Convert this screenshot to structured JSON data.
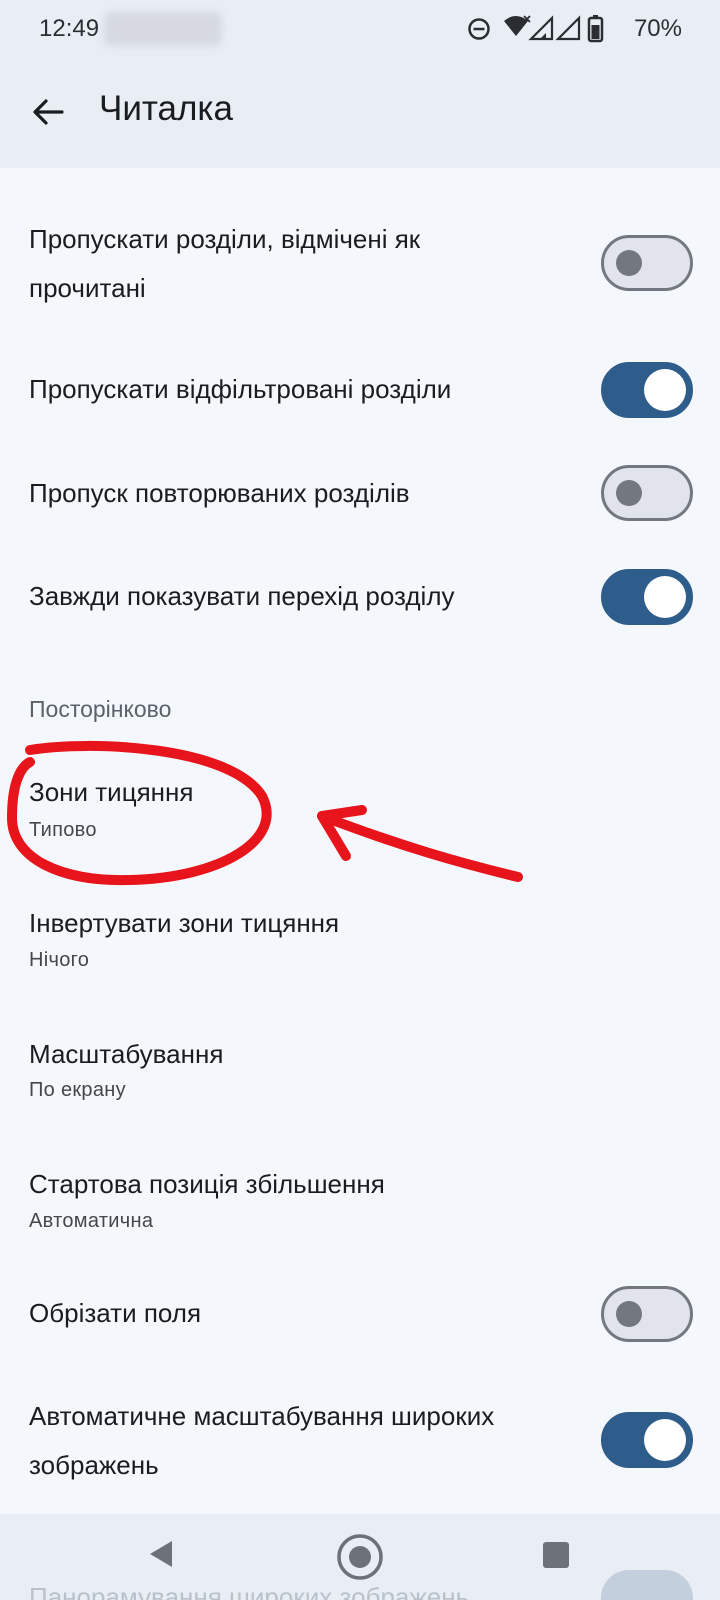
{
  "status_bar": {
    "time": "12:49",
    "battery_percent": "70%",
    "icons": [
      "do-not-disturb-icon",
      "wifi-icon",
      "signal-icon",
      "signal-icon",
      "battery-icon"
    ]
  },
  "app_bar": {
    "title": "Читалка",
    "back_icon": "arrow-left-icon"
  },
  "settings": {
    "skip_read": {
      "label": "Пропускати розділи, відмічені як прочитані",
      "line1": "Пропускати розділи, відмічені як",
      "line2": "прочитані",
      "enabled": false
    },
    "skip_filtered": {
      "label": "Пропускати відфільтровані розділи",
      "enabled": true
    },
    "skip_duplicates": {
      "label": "Пропуск повторюваних розділів",
      "enabled": false
    },
    "always_show_transition": {
      "label": "Завжди показувати перехід розділу",
      "enabled": true
    },
    "paged_header": "Посторінково",
    "tap_zones": {
      "title": "Зони тицяння",
      "summary": "Типово"
    },
    "invert_tap_zones": {
      "title": "Інвертувати зони тицяння",
      "summary": "Нічого"
    },
    "scale": {
      "title": "Масштабування",
      "summary": "По екрану"
    },
    "zoom_start": {
      "title": "Стартова позиція збільшення",
      "summary": "Автоматична"
    },
    "crop_borders": {
      "label": "Обрізати поля",
      "enabled": false
    },
    "auto_zoom_wide": {
      "line1": "Автоматичне масштабування широких",
      "line2": "зображень",
      "enabled": true
    },
    "pan_wide": {
      "label": "Панорамування широких зображень",
      "enabled": true
    }
  },
  "annotation": {
    "color": "#e8141b",
    "shape": "hand-drawn circle with arrow pointing to tap zones"
  },
  "nav_bar": {
    "icons": [
      "back-triangle-icon",
      "home-circle-icon",
      "recents-square-icon"
    ]
  },
  "colors": {
    "background": "#f4f8fd",
    "bar": "#e9eef5",
    "accent": "#2e5d8c",
    "annotation": "#e8141b"
  }
}
